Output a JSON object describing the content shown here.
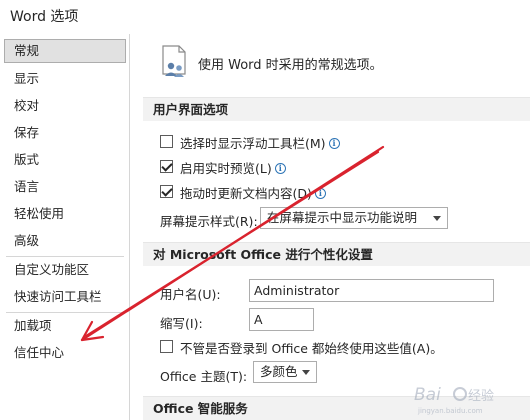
{
  "window": {
    "title": "Word 选项"
  },
  "sidebar": {
    "items": [
      {
        "label": "常规",
        "selected": true
      },
      {
        "label": "显示"
      },
      {
        "label": "校对"
      },
      {
        "label": "保存"
      },
      {
        "label": "版式"
      },
      {
        "label": "语言"
      },
      {
        "label": "轻松使用"
      },
      {
        "label": "高级"
      },
      {
        "label": "自定义功能区"
      },
      {
        "label": "快速访问工具栏"
      },
      {
        "label": "加载项"
      },
      {
        "label": "信任中心"
      }
    ]
  },
  "main": {
    "header": "使用 Word 时采用的常规选项。",
    "ui_section": {
      "title": "用户界面选项",
      "options": [
        {
          "label": "选择时显示浮动工具栏(M)",
          "checked": false
        },
        {
          "label": "启用实时预览(L)",
          "checked": true
        },
        {
          "label": "拖动时更新文档内容(D)",
          "checked": true
        }
      ],
      "screentip_label": "屏幕提示样式(R):",
      "screentip_value": "在屏幕提示中显示功能说明"
    },
    "personalize_section": {
      "title": "对 Microsoft Office 进行个性化设置",
      "username_label": "用户名(U):",
      "username_value": "Administrator",
      "initials_label": "缩写(I):",
      "initials_value": "A",
      "always_use_label": "不管是否登录到 Office 都始终使用这些值(A)。",
      "always_use_checked": false,
      "theme_label": "Office 主题(T):",
      "theme_value": "多颜色"
    },
    "intelligent_section": {
      "title": "Office 智能服务"
    }
  },
  "icons": {
    "info": "i"
  },
  "colors": {
    "annotation_arrow": "#d9232e",
    "info_blue": "#2e75b6"
  }
}
